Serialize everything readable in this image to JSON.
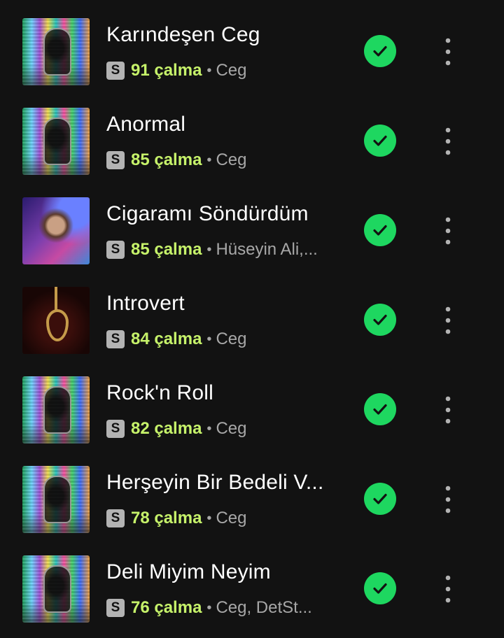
{
  "colors": {
    "background": "#121212",
    "accent_green": "#1ed760",
    "plays_green": "#c6f26a",
    "secondary_text": "#a7a7a7"
  },
  "icons": {
    "downloaded": "check-circle-icon",
    "more": "more-vertical-icon",
    "song_badge": "S"
  },
  "tracks": [
    {
      "title": "Karındeşen Ceg",
      "badge": "S",
      "plays": "91 çalma",
      "separator": "•",
      "artist": "Ceg",
      "art": "deliszyum"
    },
    {
      "title": "Anormal",
      "badge": "S",
      "plays": "85 çalma",
      "separator": "•",
      "artist": "Ceg",
      "art": "deliszyum"
    },
    {
      "title": "Cigaramı Söndürdüm",
      "badge": "S",
      "plays": "85 çalma",
      "separator": "•",
      "artist": "Hüseyin Ali,...",
      "art": "portrait"
    },
    {
      "title": "Introvert",
      "badge": "S",
      "plays": "84 çalma",
      "separator": "•",
      "artist": "Ceg",
      "art": "noose"
    },
    {
      "title": "Rock'n Roll",
      "badge": "S",
      "plays": "82 çalma",
      "separator": "•",
      "artist": "Ceg",
      "art": "deliszyum"
    },
    {
      "title": "Herşeyin Bir Bedeli V...",
      "badge": "S",
      "plays": "78 çalma",
      "separator": "•",
      "artist": "Ceg",
      "art": "deliszyum"
    },
    {
      "title": "Deli Miyim Neyim",
      "badge": "S",
      "plays": "76 çalma",
      "separator": "•",
      "artist": "Ceg, DetSt...",
      "art": "deliszyum"
    }
  ]
}
